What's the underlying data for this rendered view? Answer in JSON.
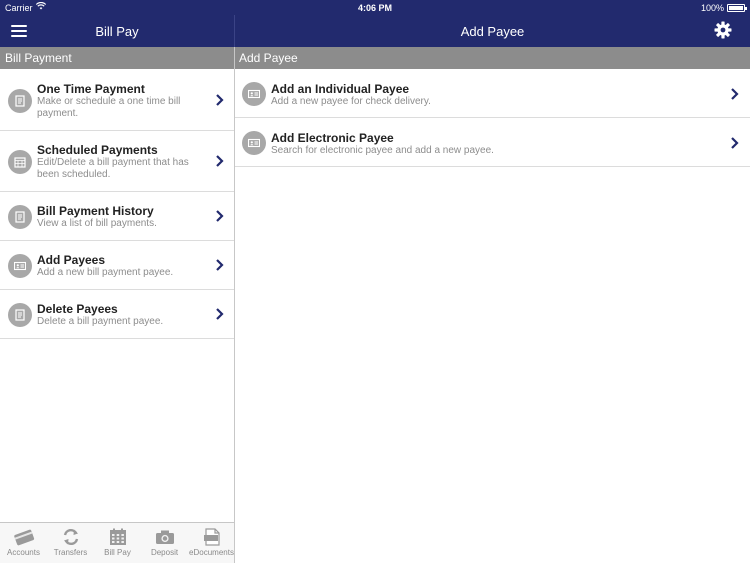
{
  "status": {
    "carrier": "Carrier",
    "time": "4:06 PM",
    "battery": "100%"
  },
  "left": {
    "title": "Bill Pay",
    "section": "Bill Payment",
    "items": [
      {
        "title": "One Time Payment",
        "desc1": "Make or schedule a one time bill",
        "desc2": "payment.",
        "icon": "document-icon"
      },
      {
        "title": "Scheduled Payments",
        "desc1": "Edit/Delete a bill payment that has",
        "desc2": "been scheduled.",
        "icon": "calendar-icon"
      },
      {
        "title": "Bill Payment History",
        "desc1": "View a list of bill payments.",
        "desc2": "",
        "icon": "document-icon"
      },
      {
        "title": "Add Payees",
        "desc1": "Add a new bill payment payee.",
        "desc2": "",
        "icon": "id-card-icon"
      },
      {
        "title": "Delete Payees",
        "desc1": "Delete a bill payment payee.",
        "desc2": "",
        "icon": "document-icon"
      }
    ]
  },
  "right": {
    "title": "Add Payee",
    "section": "Add Payee",
    "items": [
      {
        "title": "Add an Individual Payee",
        "desc": "Add a new payee for check delivery.",
        "icon": "id-card-icon"
      },
      {
        "title": "Add Electronic Payee",
        "desc": "Search for electronic payee and add a new payee.",
        "icon": "id-card-icon"
      }
    ]
  },
  "tabs": [
    {
      "label": "Accounts",
      "icon": "card-icon"
    },
    {
      "label": "Transfers",
      "icon": "transfer-icon"
    },
    {
      "label": "Bill Pay",
      "icon": "calendar-icon"
    },
    {
      "label": "Deposit",
      "icon": "camera-icon"
    },
    {
      "label": "eDocuments",
      "icon": "pdf-icon"
    }
  ],
  "colors": {
    "nav": "#222a6e",
    "subheader": "#8c8c8c",
    "chevron": "#222a6e"
  }
}
